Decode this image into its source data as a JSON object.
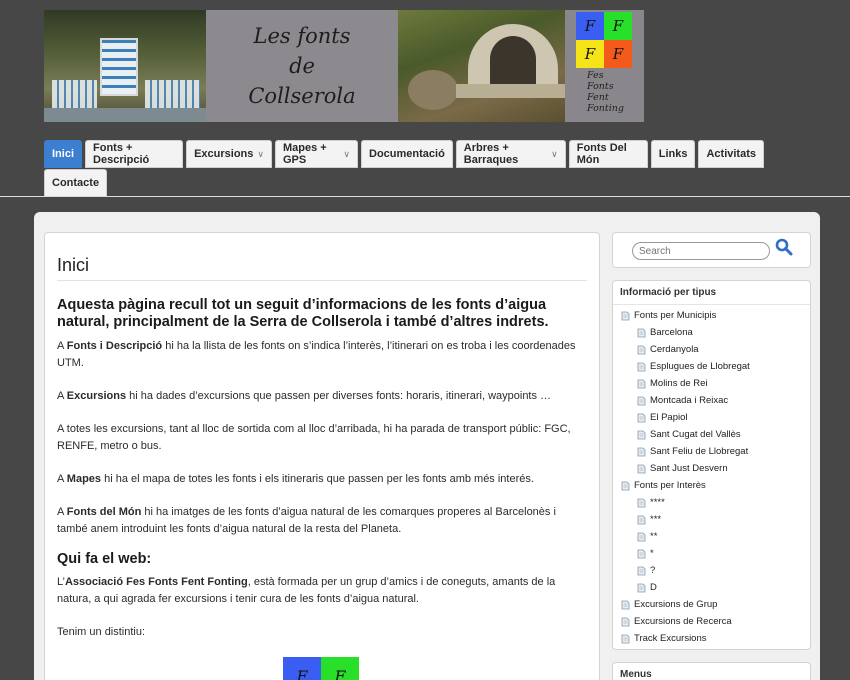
{
  "banner": {
    "title_lines": [
      "Les fonts",
      "de",
      "Collserola"
    ],
    "logo": {
      "cells": [
        "F",
        "F",
        "F",
        "F"
      ],
      "cell_colors": [
        "#3a5ef2",
        "#28e02a",
        "#f5e418",
        "#f35a1c"
      ],
      "words": [
        "Fes",
        "Fonts",
        "Fent",
        "Fonting"
      ]
    }
  },
  "nav": {
    "row1": [
      {
        "label": "Inici",
        "active": true,
        "dropdown": false
      },
      {
        "label": "Fonts + Descripció",
        "dropdown": false
      },
      {
        "label": "Excursions",
        "dropdown": true
      },
      {
        "label": "Mapes + GPS",
        "dropdown": true
      },
      {
        "label": "Documentació",
        "dropdown": false
      },
      {
        "label": "Arbres + Barraques",
        "dropdown": true
      },
      {
        "label": "Fonts Del Món",
        "dropdown": false
      },
      {
        "label": "Links",
        "dropdown": false
      },
      {
        "label": "Activitats",
        "dropdown": false
      }
    ],
    "row2": [
      {
        "label": "Contacte",
        "dropdown": false
      }
    ]
  },
  "content": {
    "title": "Inici",
    "lead": "Aquesta pàgina recull tot un seguit d’informacions de les fonts d’aigua natural, principalment de la Serra de Collserola i també d’altres indrets.",
    "p1": {
      "pre": "A ",
      "bold": "Fonts i Descripció",
      "post": " hi ha la llista de les fonts on s’indica l’interès, l’itinerari on es troba i les coordenades UTM."
    },
    "p2": {
      "pre": "A ",
      "bold": "Excursions",
      "post": " hi ha dades d’excursions que passen per diverses fonts: horaris, itinerari, waypoints …"
    },
    "p3": "A totes les excursions, tant al lloc de sortida com al lloc d’arribada, hi ha parada de transport públic: FGC, RENFE, metro o bus.",
    "p4": {
      "pre": "A ",
      "bold": "Mapes",
      "post": " hi ha el mapa de totes les fonts i els itineraris que passen per les fonts amb més interés."
    },
    "p5": {
      "pre": "A ",
      "bold": "Fonts del Món",
      "post": " hi ha imatges de les fonts d’aigua natural de les comarques properes al Barcelonès i també anem introduint les fonts d’aigua natural de la resta del Planeta."
    },
    "subtitle": "Qui fa el web:",
    "p6": {
      "pre": "L’",
      "bold": "Associació Fes Fonts Fent Fonting",
      "post": ", està formada per un grup d’amics i de coneguts, amants de la natura, a qui agrada fer excursions i tenir cura de les fonts d’aigua natural."
    },
    "p7": "Tenim un distintiu:",
    "badge": {
      "cells": [
        "F",
        "F"
      ],
      "colors": [
        "#3a5ef2",
        "#28e02a"
      ]
    }
  },
  "sidebar": {
    "search_placeholder": "Search",
    "categories_title": "Informació per tipus",
    "tree": [
      {
        "label": "Fonts per Municipis",
        "level": 1
      },
      {
        "label": "Barcelona",
        "level": 2
      },
      {
        "label": "Cerdanyola",
        "level": 2
      },
      {
        "label": "Esplugues de Llobregat",
        "level": 2
      },
      {
        "label": "Molins de Rei",
        "level": 2
      },
      {
        "label": "Montcada i Reixac",
        "level": 2
      },
      {
        "label": "El Papiol",
        "level": 2
      },
      {
        "label": "Sant Cugat del Vallès",
        "level": 2
      },
      {
        "label": "Sant Feliu de Llobregat",
        "level": 2
      },
      {
        "label": "Sant Just Desvern",
        "level": 2
      },
      {
        "label": "Fonts per Interès",
        "level": 1
      },
      {
        "label": "****",
        "level": 2
      },
      {
        "label": "***",
        "level": 2
      },
      {
        "label": "**",
        "level": 2
      },
      {
        "label": "*",
        "level": 2
      },
      {
        "label": "?",
        "level": 2
      },
      {
        "label": "D",
        "level": 2
      },
      {
        "label": "Excursions de Grup",
        "level": 1
      },
      {
        "label": "Excursions de Recerca",
        "level": 1
      },
      {
        "label": "Track Excursions",
        "level": 1
      }
    ],
    "menus_title": "Menus"
  }
}
